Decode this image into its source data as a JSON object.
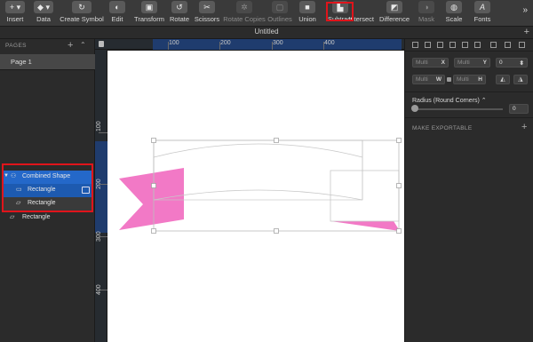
{
  "toolbar": {
    "items": [
      {
        "label": "Insert",
        "icon": "+ ▾"
      },
      {
        "label": "Data",
        "icon": "◆ ▾"
      },
      {
        "label": "Create Symbol",
        "icon": "↻"
      },
      {
        "label": "Edit",
        "icon": "◐"
      },
      {
        "label": "Transform",
        "icon": "▣"
      },
      {
        "label": "Rotate",
        "icon": "↺"
      },
      {
        "label": "Scissors",
        "icon": "✂"
      },
      {
        "label": "Rotate Copies",
        "icon": "✲"
      },
      {
        "label": "Outlines",
        "icon": "▢"
      },
      {
        "label": "Union",
        "icon": "■"
      },
      {
        "label": "Subtract",
        "icon": "▙"
      },
      {
        "label": "Intersect",
        "icon": "◧"
      },
      {
        "label": "Difference",
        "icon": "◩"
      },
      {
        "label": "Mask",
        "icon": "◑"
      },
      {
        "label": "Scale",
        "icon": "◍"
      },
      {
        "label": "Fonts",
        "icon": "A"
      }
    ],
    "more": "»"
  },
  "document": {
    "title": "Untitled",
    "add": "+"
  },
  "pages": {
    "header": "PAGES",
    "add": "+",
    "collapse": "⌃",
    "items": [
      "Page 1"
    ]
  },
  "layers": [
    {
      "name": "Combined Shape",
      "icon": "⚇",
      "disclosure": "▼"
    },
    {
      "name": "Rectangle",
      "icon": "▭"
    },
    {
      "name": "Rectangle",
      "icon": "▱"
    },
    {
      "name": "Rectangle",
      "icon": "▱"
    }
  ],
  "rulers": {
    "top": [
      "100",
      "200",
      "300",
      "400"
    ],
    "left": [
      "100",
      "200",
      "300",
      "400"
    ]
  },
  "inspector": {
    "x": {
      "placeholder": "Multi",
      "suffix": "X"
    },
    "y": {
      "placeholder": "Multi",
      "suffix": "Y"
    },
    "rotation": {
      "value": "0"
    },
    "w": {
      "placeholder": "Multi",
      "suffix": "W"
    },
    "h": {
      "placeholder": "Multi",
      "suffix": "H"
    },
    "radius_label": "Radius (Round Corners) ⌃",
    "radius_value": "0",
    "export_label": "MAKE EXPORTABLE",
    "export_add": "+"
  },
  "colors": {
    "accent": "#2468c9",
    "highlight": "#e0141b",
    "shape_fill": "#f279c6"
  }
}
